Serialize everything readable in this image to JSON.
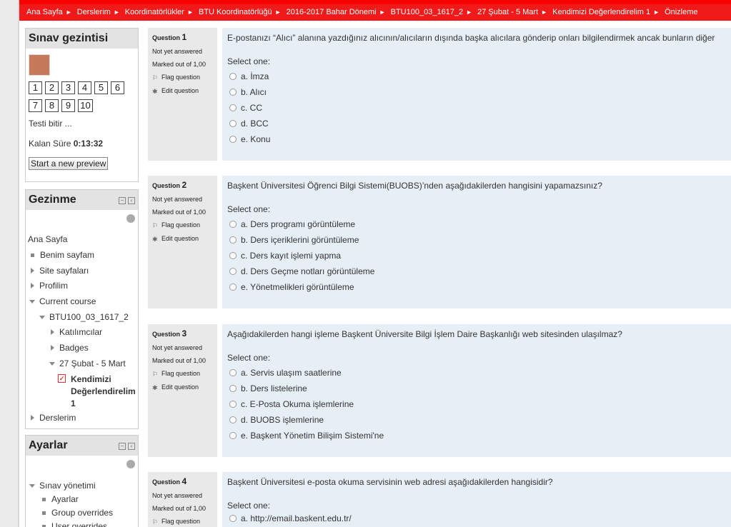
{
  "breadcrumb": [
    "Ana Sayfa",
    "Derslerim",
    "Koordinatörlükler",
    "BTU Koordinatörlüğü",
    "2016-2017 Bahar Dönemi",
    "BTU100_03_1617_2",
    "27 Şubat - 5 Mart",
    "Kendimizi Değerlendirelim 1",
    "Önizleme"
  ],
  "quiz_nav": {
    "title": "Sınav gezintisi",
    "numbers": [
      "1",
      "2",
      "3",
      "4",
      "5",
      "6",
      "7",
      "8",
      "9",
      "10"
    ],
    "finish": "Testi bitir ...",
    "time_label": "Kalan Süre",
    "time_value": "0:13:32",
    "preview_button": "Start a new preview"
  },
  "navigation": {
    "title": "Gezinme",
    "home": "Ana Sayfa",
    "my_page": "Benim sayfam",
    "site_pages": "Site sayfaları",
    "profile": "Profilim",
    "current_course": "Current course",
    "course": "BTU100_03_1617_2",
    "participants": "Katılımcılar",
    "badges": "Badges",
    "week": "27 Şubat - 5 Mart",
    "quiz_line1": "Kendimizi",
    "quiz_line2": "Değerlendirelim",
    "quiz_line3": "1",
    "my_courses": "Derslerim"
  },
  "settings": {
    "title": "Ayarlar",
    "quiz_admin": "Sınav yönetimi",
    "settings_item": "Ayarlar",
    "group_overrides": "Group overrides",
    "user_overrides": "User overrides"
  },
  "info_labels": {
    "question": "Question",
    "status": "Not yet answered",
    "marked": "Marked out of 1,00",
    "flag": "Flag question",
    "edit": "Edit question",
    "select_one": "Select one:"
  },
  "questions": [
    {
      "number": "1",
      "text": "E-postanızı “Alıcı” alanına yazdığınız alıcının/alıcıların dışında başka alıcılara gönderip onları bilgilendirmek ancak bunların diğer",
      "options": [
        "a. İmza",
        "b. Alıcı",
        "c. CC",
        "d. BCC",
        "e. Konu"
      ]
    },
    {
      "number": "2",
      "text": "Başkent Üniversitesi Öğrenci Bilgi Sistemi(BUOBS)’nden aşağıdakilerden hangisini yapamazsınız?",
      "options": [
        "a. Ders programı görüntüleme",
        "b. Ders içeriklerini görüntüleme",
        "c. Ders kayıt işlemi yapma",
        "d. Ders Geçme notları görüntüleme",
        "e. Yönetmelikleri görüntüleme"
      ]
    },
    {
      "number": "3",
      "text": "Aşağıdakilerden hangi işleme Başkent Üniversite Bilgi İşlem Daire Başkanlığı web sitesinden ulaşılmaz?",
      "options": [
        "a. Servis ulaşım saatlerine",
        "b. Ders listelerine",
        "c. E-Posta Okuma işlemlerine",
        "d. BUOBS işlemlerine",
        "e. Başkent Yönetim Bilişim Sistemi'ne"
      ]
    },
    {
      "number": "4",
      "text": "Başkent Üniversitesi e-posta okuma servisinin web adresi aşağıdakilerden hangisidir?",
      "options": [
        "a. http://email.baskent.edu.tr/"
      ]
    }
  ]
}
